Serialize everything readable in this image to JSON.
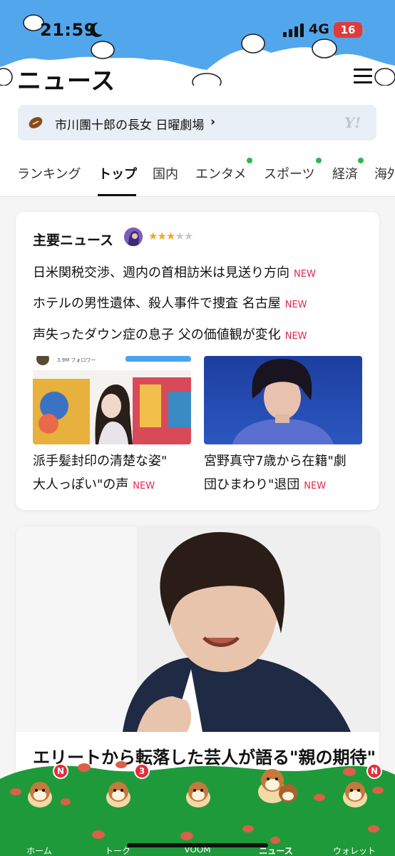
{
  "status_bar": {
    "time": "21:59",
    "network": "4G",
    "battery": "16"
  },
  "header": {
    "title": "ニュース",
    "menu_icon": "hamburger-icon"
  },
  "banner": {
    "text": "市川團十郎の長女 日曜劇場",
    "chevron": "›",
    "logo": "Y!"
  },
  "tabs": [
    {
      "label": "ランキング",
      "active": false,
      "dot": false
    },
    {
      "label": "トップ",
      "active": true,
      "dot": false
    },
    {
      "label": "国内",
      "active": false,
      "dot": false
    },
    {
      "label": "エンタメ",
      "active": false,
      "dot": true
    },
    {
      "label": "スポーツ",
      "active": false,
      "dot": true
    },
    {
      "label": "経済",
      "active": false,
      "dot": true
    },
    {
      "label": "海外",
      "active": false,
      "dot": false
    }
  ],
  "main_news": {
    "title": "主要ニュース",
    "rating": 3,
    "rating_max": 5,
    "new_label": "NEW",
    "headlines": [
      "日米関税交渉、週内の首相訪米は見送り方向",
      "ホテルの男性遺体、殺人事件で捜査 名古屋",
      "声失ったダウン症の息子 父の価値観が変化"
    ],
    "thumbs": [
      {
        "caption1": "派手髪封印の清楚な姿\"",
        "caption2": "大人っぽい\"の声",
        "overlay_text": "3.9M フォロワー"
      },
      {
        "caption1": "宮野真守7歳から在籍\"劇",
        "caption2": "団ひまわり\"退団"
      }
    ]
  },
  "feature": {
    "title": "エリートから転落した芸人が語る\"親の期待\""
  },
  "bottom_nav": [
    {
      "label": "ホーム",
      "badge": "N",
      "active": false
    },
    {
      "label": "トーク",
      "badge": "3",
      "active": false
    },
    {
      "label": "VOOM",
      "badge": "",
      "active": false
    },
    {
      "label": "ニュース",
      "badge": "",
      "active": true
    },
    {
      "label": "ウォレット",
      "badge": "N",
      "active": false
    }
  ],
  "colors": {
    "sky": "#52a7ec",
    "grass": "#1f9a3a",
    "accent_new": "#e0284f",
    "badge": "#e52c3a",
    "star": "#f5a623"
  }
}
